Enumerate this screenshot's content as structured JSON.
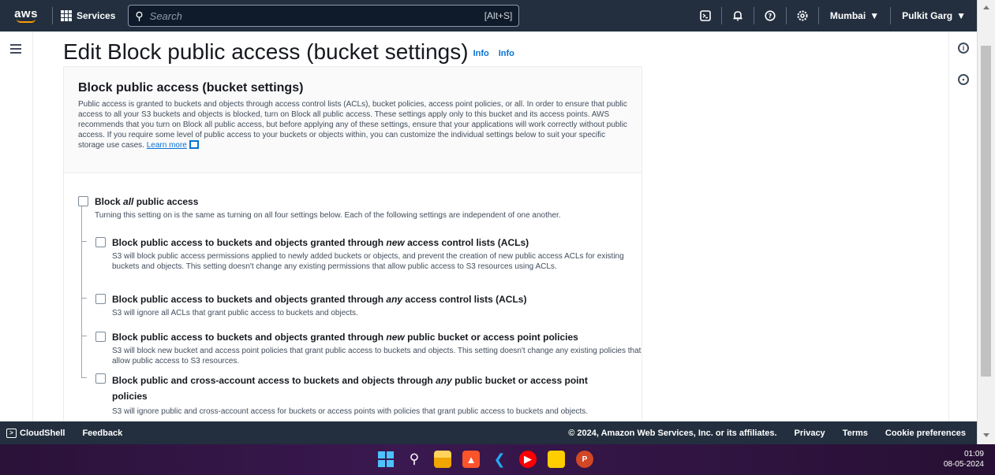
{
  "topnav": {
    "logo": "aws",
    "services": "Services",
    "search_placeholder": "Search",
    "search_shortcut": "[Alt+S]",
    "region": "Mumbai",
    "user": "Pulkit Garg",
    "icons": [
      "cloudshell-icon",
      "bell-icon",
      "help-icon",
      "settings-icon"
    ]
  },
  "page": {
    "title": "Edit Block public access (bucket settings)",
    "info1": "Info",
    "info2": "Info"
  },
  "panel": {
    "heading": "Block public access (bucket settings)",
    "description": "Public access is granted to buckets and objects through access control lists (ACLs), bucket policies, access point policies, or all. In order to ensure that public access to all your S3 buckets and objects is blocked, turn on Block all public access. These settings apply only to this bucket and its access points. AWS recommends that you turn on Block all public access, but before applying any of these settings, ensure that your applications will work correctly without public access. If you require some level of public access to your buckets or objects within, you can customize the individual settings below to suit your specific storage use cases.",
    "learn_more": "Learn more",
    "block_all": {
      "title_prefix": "Block ",
      "title_em": "all",
      "title_suffix": " public access",
      "desc": "Turning this setting on is the same as turning on all four settings below. Each of the following settings are independent of one another.",
      "checked": false
    },
    "options": [
      {
        "prefix": "Block public access to buckets and objects granted through ",
        "em": "new",
        "suffix": " access control lists (ACLs)",
        "desc": "S3 will block public access permissions applied to newly added buckets or objects, and prevent the creation of new public access ACLs for existing buckets and objects. This setting doesn't change any existing permissions that allow public access to S3 resources using ACLs.",
        "checked": false
      },
      {
        "prefix": "Block public access to buckets and objects granted through ",
        "em": "any",
        "suffix": " access control lists (ACLs)",
        "desc": "S3 will ignore all ACLs that grant public access to buckets and objects.",
        "checked": false
      },
      {
        "prefix": "Block public access to buckets and objects granted through ",
        "em": "new",
        "suffix": " public bucket or access point policies",
        "desc": "S3 will block new bucket and access point policies that grant public access to buckets and objects. This setting doesn't change any existing policies that allow public access to S3 resources.",
        "checked": false
      },
      {
        "prefix": "Block public and cross-account access to buckets and objects through ",
        "em": "any",
        "suffix": " public bucket or access point policies",
        "desc": "S3 will ignore public and cross-account access for buckets or access points with policies that grant public access to buckets and objects.",
        "checked": false
      }
    ]
  },
  "footer": {
    "cloudshell": "CloudShell",
    "feedback": "Feedback",
    "copyright": "© 2024, Amazon Web Services, Inc. or its affiliates.",
    "privacy": "Privacy",
    "terms": "Terms",
    "cookie": "Cookie preferences"
  },
  "taskbar": {
    "time": "01:09",
    "date": "08-05-2024"
  },
  "colors": {
    "nav_bg": "#232f3e",
    "link": "#0972d3",
    "accent": "#ff9900"
  }
}
